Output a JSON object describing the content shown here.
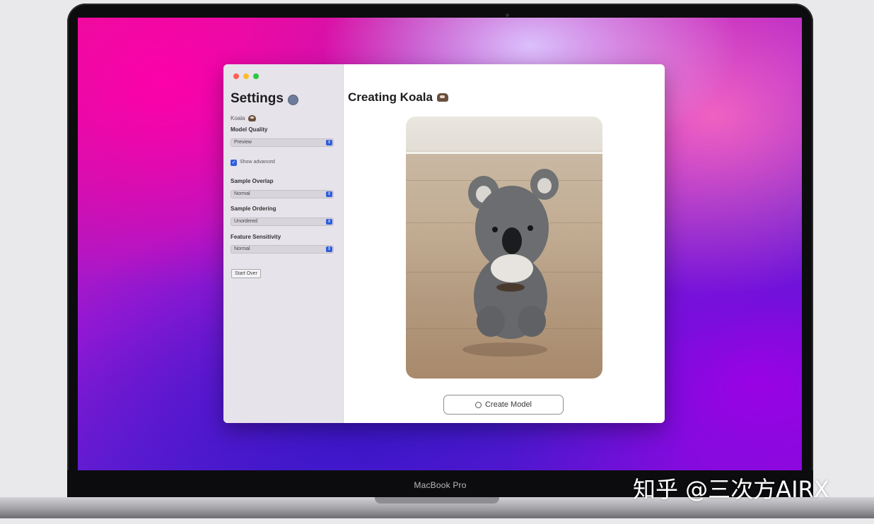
{
  "device": {
    "model_label": "MacBook Pro"
  },
  "watermark": "知乎 @三次方AIRX",
  "window": {
    "sidebar": {
      "title": "Settings",
      "subject_label": "Koala",
      "model_quality": {
        "label": "Model Quality",
        "value": "Preview"
      },
      "show_advanced": {
        "label": "Show advanced",
        "checked": true
      },
      "sample_overlap": {
        "label": "Sample Overlap",
        "value": "Normal"
      },
      "sample_ordering": {
        "label": "Sample Ordering",
        "value": "Unordered"
      },
      "feature_sensitivity": {
        "label": "Feature Sensitivity",
        "value": "Normal"
      },
      "start_over": "Start Over"
    },
    "main": {
      "title": "Creating Koala",
      "create_button": "Create Model"
    }
  },
  "colors": {
    "accent": "#2f5ddb",
    "close": "#fe5f57",
    "minimize": "#febc2e",
    "zoom": "#28c840"
  },
  "icons": [
    "gear-icon",
    "koala-emoji-icon",
    "cube-icon",
    "chevron-updown-icon",
    "checkmark-icon"
  ]
}
